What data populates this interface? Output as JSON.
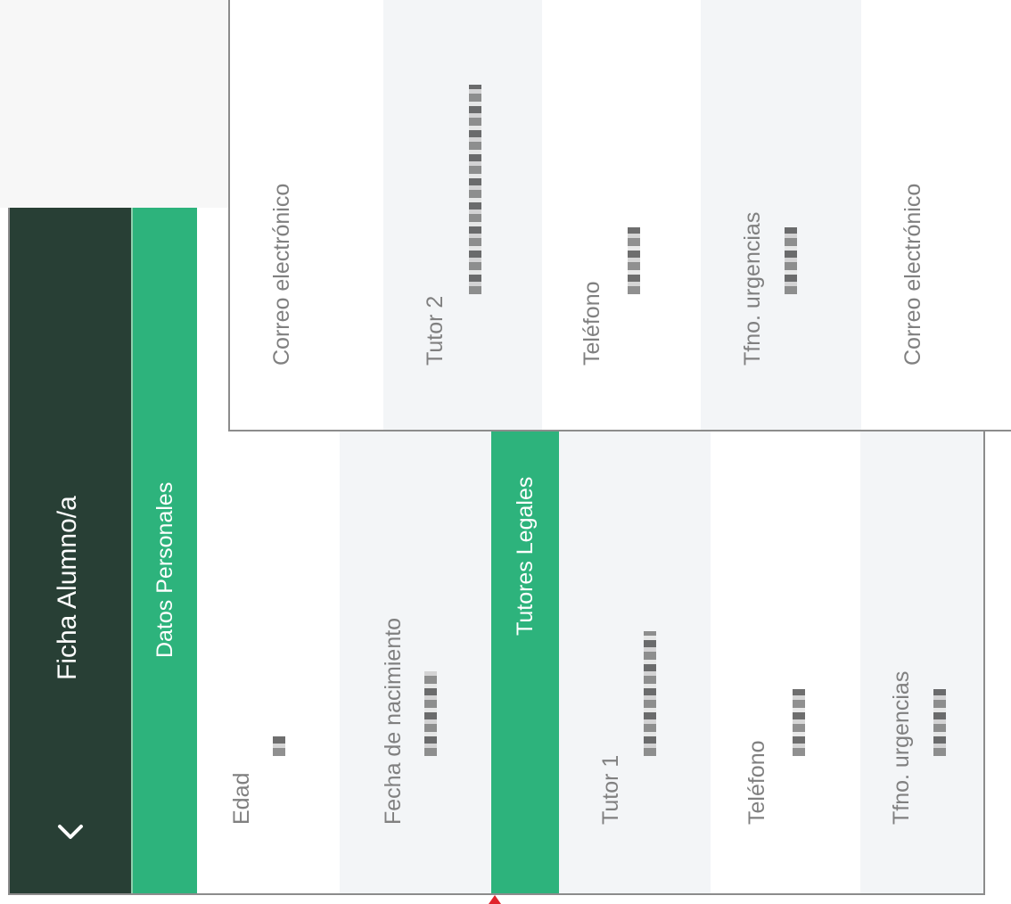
{
  "header": {
    "title": "Ficha Alumno/a"
  },
  "sections": {
    "datos_personales": "Datos Personales",
    "tutores_legales": "Tutores Legales"
  },
  "fields": {
    "edad": "Edad",
    "fecha_nacimiento": "Fecha de nacimiento",
    "tutor1": "Tutor 1",
    "telefono1": "Teléfono",
    "urgencias1": "Tfno. urgencias",
    "correo1": "Correo electrónico",
    "tutor2": "Tutor 2",
    "telefono2": "Teléfono",
    "urgencias2": "Tfno. urgencias",
    "correo2": "Correo electrónico"
  },
  "icons": {
    "collapse": "chevron-down-icon",
    "pointer": "red-arrow-marker"
  },
  "colors": {
    "header_bg": "#283f35",
    "section_bg": "#2db37c",
    "stripe_bg": "#f3f5f7",
    "marker": "#e0242c"
  }
}
